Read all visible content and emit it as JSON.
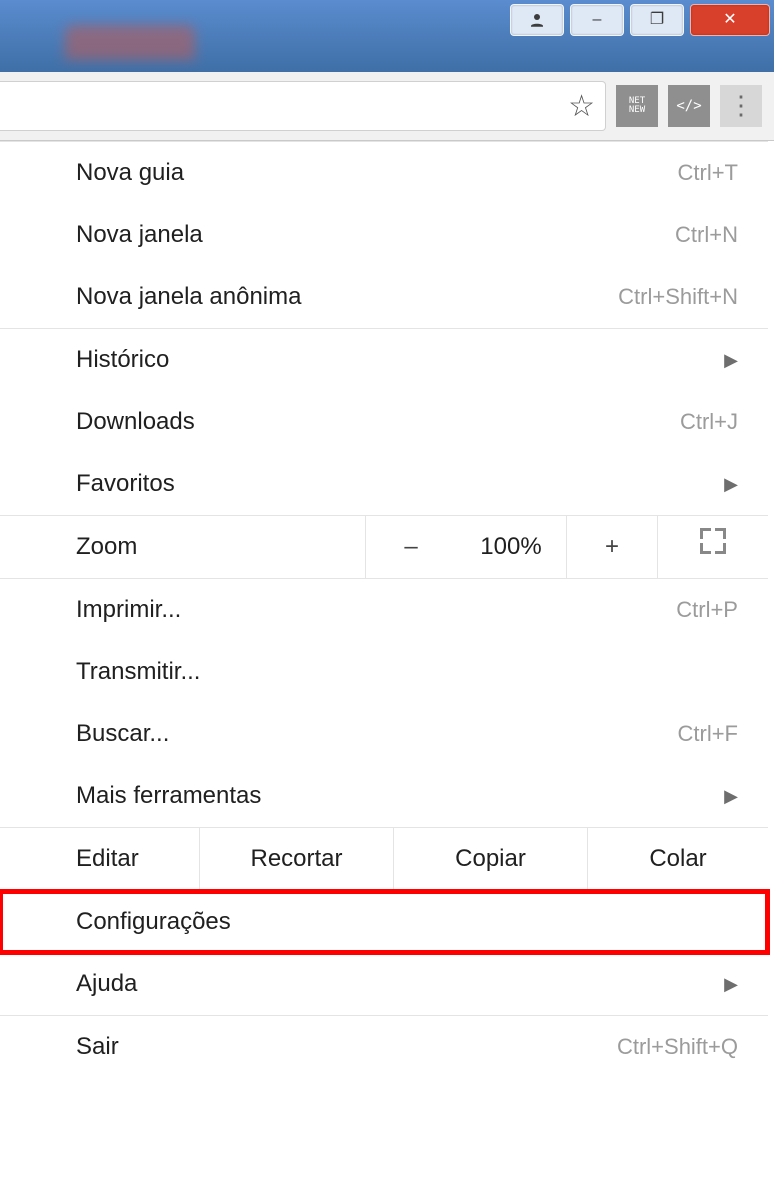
{
  "window": {
    "user_icon": "person-icon",
    "minimize": "–",
    "maximize": "❐",
    "close": "✕"
  },
  "toolbar": {
    "star": "☆",
    "ext1": "NET\nNEW",
    "ext2": "</>",
    "menu": "⋮"
  },
  "menu": {
    "new_tab": {
      "label": "Nova guia",
      "shortcut": "Ctrl+T"
    },
    "new_window": {
      "label": "Nova janela",
      "shortcut": "Ctrl+N"
    },
    "incognito": {
      "label": "Nova janela anônima",
      "shortcut": "Ctrl+Shift+N"
    },
    "history": {
      "label": "Histórico",
      "arrow": "▶"
    },
    "downloads": {
      "label": "Downloads",
      "shortcut": "Ctrl+J"
    },
    "bookmarks": {
      "label": "Favoritos",
      "arrow": "▶"
    },
    "zoom": {
      "label": "Zoom",
      "minus": "–",
      "pct": "100%",
      "plus": "+"
    },
    "print": {
      "label": "Imprimir...",
      "shortcut": "Ctrl+P"
    },
    "cast": {
      "label": "Transmitir..."
    },
    "find": {
      "label": "Buscar...",
      "shortcut": "Ctrl+F"
    },
    "more_tools": {
      "label": "Mais ferramentas",
      "arrow": "▶"
    },
    "edit": {
      "label": "Editar",
      "cut": "Recortar",
      "copy": "Copiar",
      "paste": "Colar"
    },
    "settings": {
      "label": "Configurações"
    },
    "help": {
      "label": "Ajuda",
      "arrow": "▶"
    },
    "exit": {
      "label": "Sair",
      "shortcut": "Ctrl+Shift+Q"
    }
  }
}
